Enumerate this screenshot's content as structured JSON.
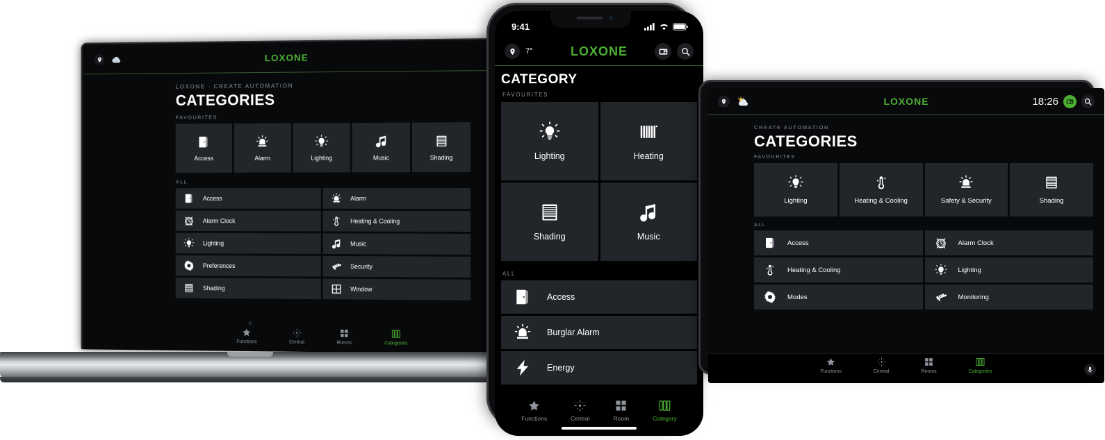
{
  "brand": {
    "name": "LOXONE",
    "accent": "#4caf32",
    "tile_bg": "#22262b",
    "screen_bg": "#0a0a0c"
  },
  "laptop": {
    "topbar": {
      "location_icon": "location-pin-icon",
      "weather_icon": "cloud-icon",
      "logo": "LOXONE"
    },
    "breadcrumb": "LOXONE · CREATE AUTOMATION",
    "title": "CATEGORIES",
    "favourites_label": "FAVOURITES",
    "favourites": [
      {
        "label": "Access",
        "icon": "door-icon"
      },
      {
        "label": "Alarm",
        "icon": "siren-icon"
      },
      {
        "label": "Lighting",
        "icon": "lightbulb-icon"
      },
      {
        "label": "Music",
        "icon": "music-note-icon"
      },
      {
        "label": "Shading",
        "icon": "blinds-icon"
      }
    ],
    "all_label": "ALL",
    "all": [
      {
        "label": "Access",
        "icon": "door-icon"
      },
      {
        "label": "Alarm",
        "icon": "siren-icon"
      },
      {
        "label": "Alarm Clock",
        "icon": "alarm-clock-icon"
      },
      {
        "label": "Heating & Cooling",
        "icon": "thermometer-icon"
      },
      {
        "label": "Lighting",
        "icon": "lightbulb-icon"
      },
      {
        "label": "Music",
        "icon": "music-note-icon"
      },
      {
        "label": "Preferences",
        "icon": "gear-icon"
      },
      {
        "label": "Security",
        "icon": "camera-icon"
      },
      {
        "label": "Shading",
        "icon": "blinds-icon"
      },
      {
        "label": "Window",
        "icon": "window-icon"
      }
    ],
    "nav": [
      {
        "label": "Functions",
        "icon": "star-icon",
        "active": false
      },
      {
        "label": "Central",
        "icon": "central-icon",
        "active": false
      },
      {
        "label": "Rooms",
        "icon": "grid-icon",
        "active": false
      },
      {
        "label": "Categories",
        "icon": "categories-icon",
        "active": true
      }
    ]
  },
  "phone": {
    "status": {
      "time": "9:41",
      "signal_icon": "cellular-icon",
      "wifi_icon": "wifi-icon",
      "battery_icon": "battery-icon"
    },
    "topbar": {
      "location_icon": "location-pin-icon",
      "temperature": "7°",
      "logo": "LOXONE",
      "intercom_icon": "intercom-icon",
      "search_icon": "search-icon"
    },
    "title": "CATEGORY",
    "favourites_label": "FAVOURITES",
    "favourites": [
      {
        "label": "Lighting",
        "icon": "lightbulb-icon"
      },
      {
        "label": "Heating",
        "icon": "radiator-icon"
      },
      {
        "label": "Shading",
        "icon": "blinds-icon"
      },
      {
        "label": "Music",
        "icon": "music-note-icon"
      }
    ],
    "all_label": "ALL",
    "all": [
      {
        "label": "Access",
        "icon": "door-icon"
      },
      {
        "label": "Burglar Alarm",
        "icon": "siren-icon"
      },
      {
        "label": "Energy",
        "icon": "bolt-icon"
      }
    ],
    "nav": [
      {
        "label": "Functions",
        "icon": "star-icon",
        "active": false
      },
      {
        "label": "Central",
        "icon": "central-icon",
        "active": false
      },
      {
        "label": "Room",
        "icon": "grid-icon",
        "active": false
      },
      {
        "label": "Category",
        "icon": "categories-icon",
        "active": true
      }
    ]
  },
  "tablet": {
    "topbar": {
      "location_icon": "location-pin-icon",
      "weather_icon": "sun-cloud-icon",
      "logo": "LOXONE",
      "clock": "18:26",
      "intercom_icon": "intercom-icon",
      "search_icon": "search-icon"
    },
    "breadcrumb": "CREATE AUTOMATION",
    "title": "CATEGORIES",
    "favourites_label": "FAVOURITES",
    "favourites": [
      {
        "label": "Lighting",
        "icon": "lightbulb-icon"
      },
      {
        "label": "Heating & Cooling",
        "icon": "thermometer-icon"
      },
      {
        "label": "Safety & Security",
        "icon": "siren-icon"
      },
      {
        "label": "Shading",
        "icon": "blinds-icon"
      }
    ],
    "all_label": "ALL",
    "all": [
      {
        "label": "Access",
        "icon": "door-icon"
      },
      {
        "label": "Alarm Clock",
        "icon": "alarm-clock-icon"
      },
      {
        "label": "Heating & Cooling",
        "icon": "thermometer-icon"
      },
      {
        "label": "Lighting",
        "icon": "lightbulb-icon"
      },
      {
        "label": "Modes",
        "icon": "gear-icon"
      },
      {
        "label": "Monitoring",
        "icon": "camera-icon"
      }
    ],
    "nav": [
      {
        "label": "Functions",
        "icon": "star-icon",
        "active": false
      },
      {
        "label": "Central",
        "icon": "central-icon",
        "active": false
      },
      {
        "label": "Rooms",
        "icon": "grid-icon",
        "active": false
      },
      {
        "label": "Categories",
        "icon": "categories-icon",
        "active": true
      }
    ],
    "mic_icon": "microphone-icon"
  }
}
